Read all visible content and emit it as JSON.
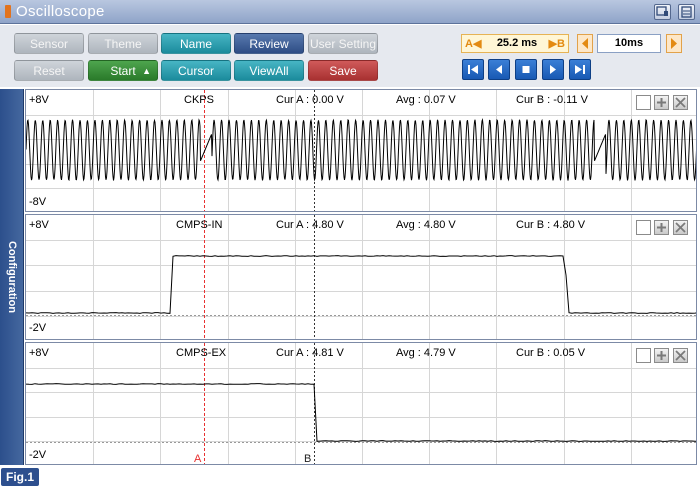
{
  "window": {
    "title": "Oscilloscope"
  },
  "toolbar": {
    "sensor": "Sensor",
    "theme": "Theme",
    "name": "Name",
    "review": "Review",
    "user_setting": "User Setting",
    "reset": "Reset",
    "start": "Start",
    "cursor": "Cursor",
    "view_all": "ViewAll",
    "save": "Save"
  },
  "timebase": {
    "cursor_a": "A",
    "cursor_b": "B",
    "delta": "25.2 ms",
    "time_div": "10ms"
  },
  "sidebar": {
    "tab": "Configuration"
  },
  "channels": [
    {
      "name": "CKPS",
      "vmax": "+8V",
      "vmin": "-8V",
      "cur_a": "Cur A : 0.00 V",
      "avg": "Avg : 0.07 V",
      "cur_b": "Cur B : -0.11 V"
    },
    {
      "name": "CMPS-IN",
      "vmax": "+8V",
      "vmin": "-2V",
      "cur_a": "Cur A : 4.80 V",
      "avg": "Avg : 4.80 V",
      "cur_b": "Cur B : 4.80 V"
    },
    {
      "name": "CMPS-EX",
      "vmax": "+8V",
      "vmin": "-2V",
      "cur_a": "Cur A : 4.81 V",
      "avg": "Avg : 4.79 V",
      "cur_b": "Cur B : 0.05 V"
    }
  ],
  "cursors": {
    "a": "A",
    "b": "B"
  },
  "figure": {
    "label": "Fig.1"
  },
  "colors": {
    "cursor_a": "#e83030",
    "cursor_b": "#333333",
    "trace": "#000000"
  }
}
